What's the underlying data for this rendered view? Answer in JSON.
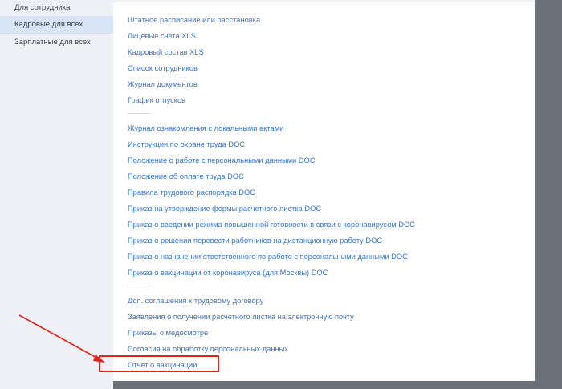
{
  "sidebar": {
    "items": [
      {
        "label": "Для сотрудника",
        "active": false
      },
      {
        "label": "Кадровые для всех",
        "active": true
      },
      {
        "label": "Зарплатные для всех",
        "active": false
      }
    ]
  },
  "links": {
    "group1": [
      "Штатное расписание или расстановка",
      "Лицевые счета XLS",
      "Кадровый состав XLS",
      "Список сотрудников",
      "Журнал документов",
      "График отпусков"
    ],
    "group2": [
      "Журнал ознакомления с локальными актами",
      "Инструкции по охране труда DOC",
      "Положение о работе с персональными данными DOC",
      "Положение об оплате труда DOC",
      "Правила трудового распорядка DOC",
      "Приказ на утверждение формы расчетного листка DOC",
      "Приказ о введении режима повышенной готовности в связи с коронавирусом DOC",
      "Приказ о решении перевести работников на дистанционную работу DOC",
      "Приказ о назначении ответственного по работе с персональными данными DOC",
      "Приказ о вакцинации от коронавируса (для Москвы) DOC"
    ],
    "group3": [
      "Доп. соглашения к трудовому договору",
      "Заявления о получении расчетного листка на электронную почту",
      "Приказы о медосмотре",
      "Согласия на обработку персональных данных",
      "Отчет о вакцинации"
    ]
  },
  "annotation": {
    "color": "#e2231a",
    "target": "Отчет о вакцинации"
  }
}
